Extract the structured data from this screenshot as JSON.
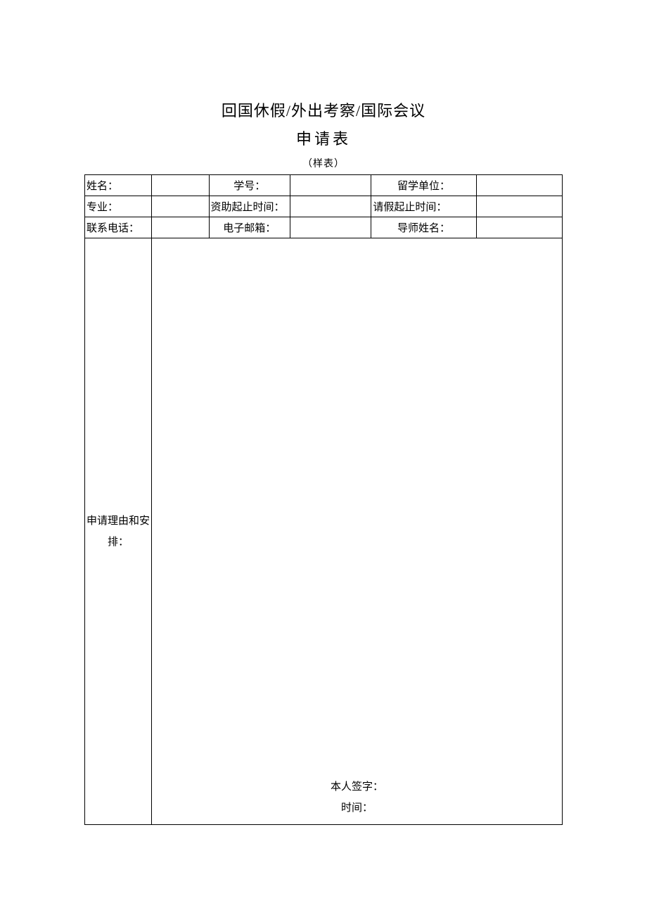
{
  "title": {
    "line1": "回国休假/外出考察/国际会议",
    "line2": "申请表",
    "subtitle": "（样表）"
  },
  "form": {
    "row1": {
      "name_label": "姓名：",
      "name_value": "",
      "student_id_label": "学号：",
      "student_id_value": "",
      "study_unit_label": "留学单位：",
      "study_unit_value": ""
    },
    "row2": {
      "major_label": "专业：",
      "major_value": "",
      "funding_period_label": "资助起止时间：",
      "funding_period_value": "",
      "leave_period_label": "请假起止时间：",
      "leave_period_value": ""
    },
    "row3": {
      "phone_label": "联系电话：",
      "phone_value": "",
      "email_label": "电子邮箱：",
      "email_value": "",
      "advisor_label": "导师姓名：",
      "advisor_value": ""
    },
    "reason": {
      "label": "申请理由和安排：",
      "content": "",
      "signature_label": "本人签字：",
      "date_label": "时间："
    }
  }
}
